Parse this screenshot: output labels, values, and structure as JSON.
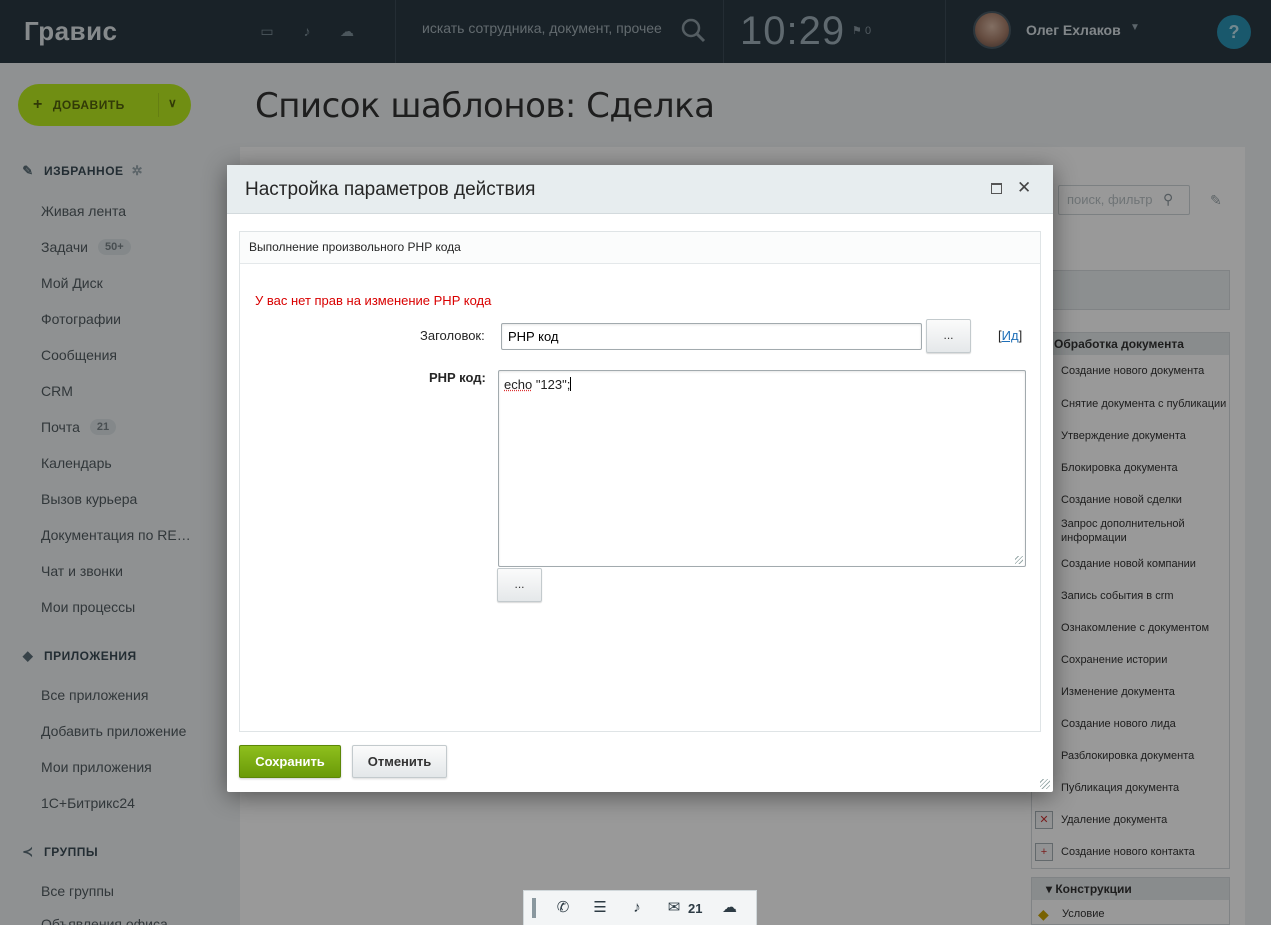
{
  "header": {
    "logo": "Гравис",
    "search_placeholder": "искать сотрудника, документ, прочее",
    "clock": "10:29",
    "flag_count": "0",
    "username": "Олег Ехлаков",
    "help_label": "?"
  },
  "sidebar": {
    "add_button": "ДОБАВИТЬ",
    "favorites_title": "ИЗБРАННОЕ",
    "favorites": [
      {
        "label": "Живая лента"
      },
      {
        "label": "Задачи",
        "badge": "50+"
      },
      {
        "label": "Мой Диск"
      },
      {
        "label": "Фотографии"
      },
      {
        "label": "Сообщения"
      },
      {
        "label": "CRM"
      },
      {
        "label": "Почта",
        "badge": "21"
      },
      {
        "label": "Календарь"
      },
      {
        "label": "Вызов курьера"
      },
      {
        "label": "Документация по RE…"
      },
      {
        "label": "Чат и звонки"
      },
      {
        "label": "Мои процессы"
      }
    ],
    "apps_title": "ПРИЛОЖЕНИЯ",
    "apps": [
      {
        "label": "Все приложения"
      },
      {
        "label": "Добавить приложение"
      },
      {
        "label": "Мои приложения"
      },
      {
        "label": "1С+Битрикс24"
      }
    ],
    "groups_title": "ГРУППЫ",
    "groups": [
      {
        "label": "Все группы"
      },
      {
        "label": "Объявления офиса"
      }
    ]
  },
  "page": {
    "title": "Список шаблонов: Сделка",
    "right_search_placeholder": "поиск, фильтр",
    "activities_head": "Обработка документа",
    "activities": [
      "Создание нового документа",
      "Снятие документа с публикации",
      "Утверждение документа",
      "Блокировка документа",
      "Создание новой сделки",
      "Запрос дополнительной информации",
      "Создание новой компании",
      "Запись события в crm",
      "Ознакомление с документом",
      "Сохранение истории",
      "Изменение документа",
      "Создание нового лида",
      "Разблокировка документа",
      "Публикация документа",
      "Удаление документа",
      "Создание нового контакта"
    ],
    "constructs_head": "Конструкции",
    "constructs": [
      "Условие"
    ]
  },
  "dialog": {
    "title": "Настройка параметров действия",
    "section_title": "Выполнение произвольного PHP кода",
    "error": "У вас нет прав на изменение PHP кода",
    "title_label": "Заголовок:",
    "title_value": "PHP код",
    "dots_label": "...",
    "id_open": "[",
    "id_link": "Ид",
    "id_close": "]",
    "php_label": "PHP код:",
    "code_keyword": "echo",
    "code_rest": " \"123\";",
    "save": "Сохранить",
    "cancel": "Отменить"
  },
  "dock": {
    "mail_count": "21"
  }
}
